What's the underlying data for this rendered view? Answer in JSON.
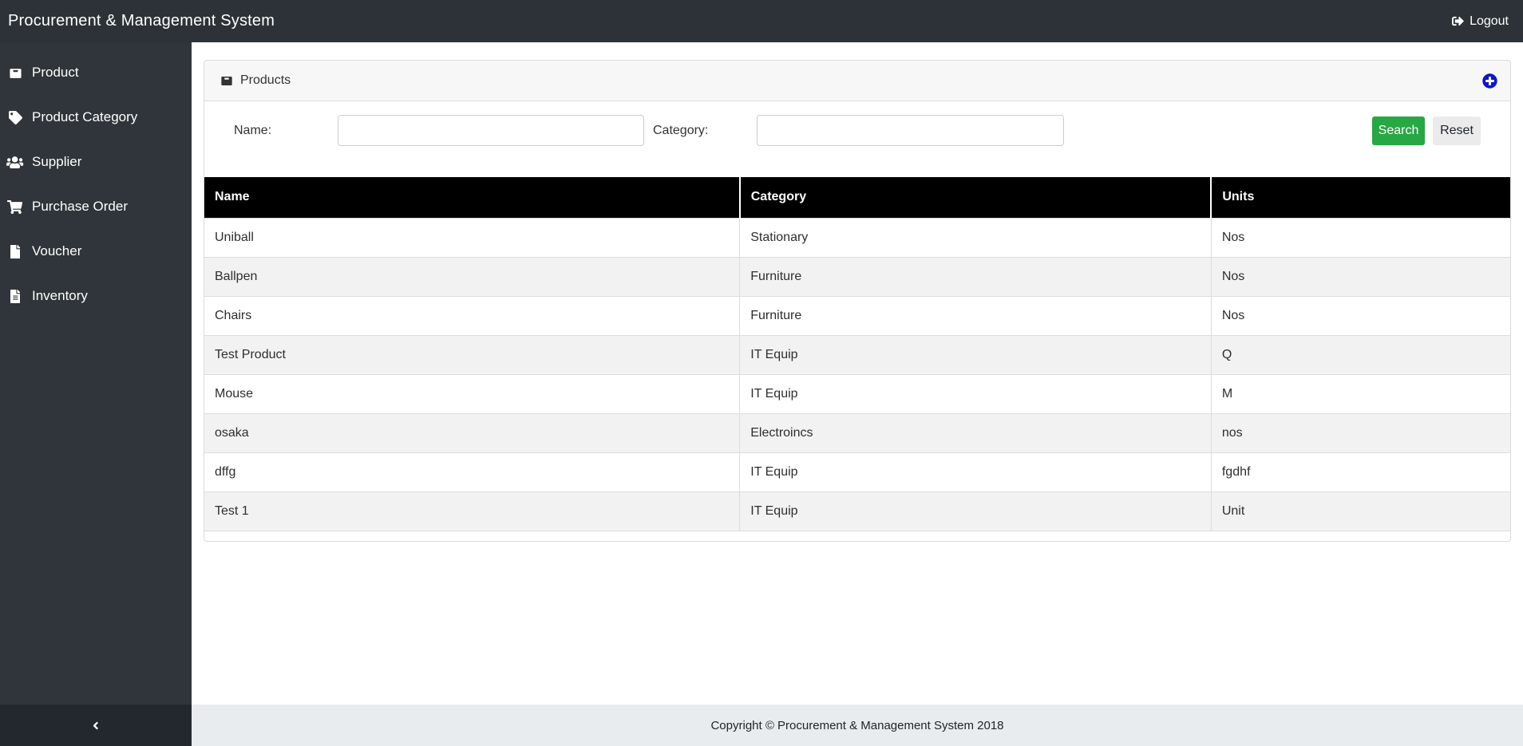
{
  "navbar": {
    "title": "Procurement & Management System",
    "logout_label": "Logout",
    "logout_icon": "logout-icon"
  },
  "sidebar": {
    "items": [
      {
        "label": "Product",
        "icon": "box-icon"
      },
      {
        "label": "Product Category",
        "icon": "tag-icon"
      },
      {
        "label": "Supplier",
        "icon": "users-icon"
      },
      {
        "label": "Purchase Order",
        "icon": "cart-icon"
      },
      {
        "label": "Voucher",
        "icon": "file-icon"
      },
      {
        "label": "Inventory",
        "icon": "file-text-icon"
      }
    ],
    "collapse_icon": "chevron-left-icon"
  },
  "panel": {
    "title": "Products",
    "title_icon": "box-icon",
    "add_icon": "plus-circle-icon",
    "search": {
      "name_label": "Name:",
      "name_value": "",
      "category_label": "Category:",
      "category_value": "",
      "search_button": "Search",
      "reset_button": "Reset"
    },
    "table": {
      "columns": [
        "Name",
        "Category",
        "Units"
      ],
      "rows": [
        [
          "Uniball",
          "Stationary",
          "Nos"
        ],
        [
          "Ballpen",
          "Furniture",
          "Nos"
        ],
        [
          "Chairs",
          "Furniture",
          "Nos"
        ],
        [
          "Test Product",
          "IT Equip",
          "Q"
        ],
        [
          "Mouse",
          "IT Equip",
          "M"
        ],
        [
          "osaka",
          "Electroincs",
          "nos"
        ],
        [
          "dffg",
          "IT Equip",
          "fgdhf"
        ],
        [
          "Test 1",
          "IT Equip",
          "Unit"
        ]
      ]
    }
  },
  "footer": {
    "copyright": "Copyright © Procurement & Management System 2018"
  },
  "colors": {
    "search_button_green": "#28a745",
    "add_button_blue": "#0c17cd",
    "table_header_bg": "#000000",
    "navbar_bg": "#2c3237",
    "sidebar_bg": "#2f353a"
  }
}
